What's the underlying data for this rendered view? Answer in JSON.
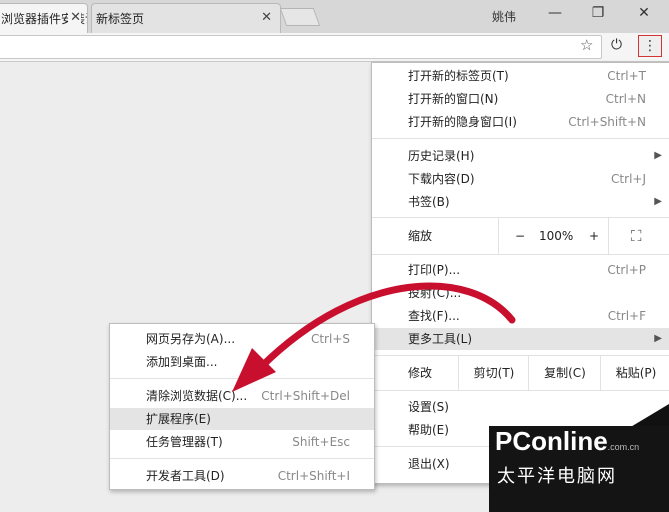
{
  "tabs": [
    {
      "title": "浏览器插件安装说",
      "close": "✕"
    },
    {
      "title": "新标签页",
      "close": "✕"
    }
  ],
  "window": {
    "user": "姚伟",
    "minimize": "—",
    "maximize": "❐",
    "close": "✕"
  },
  "toolbar": {
    "star": "☆",
    "power": "⏻",
    "menu": "⋮"
  },
  "main_menu": {
    "group1": [
      {
        "label": "打开新的标签页(T)",
        "shortcut": "Ctrl+T"
      },
      {
        "label": "打开新的窗口(N)",
        "shortcut": "Ctrl+N"
      },
      {
        "label": "打开新的隐身窗口(I)",
        "shortcut": "Ctrl+Shift+N"
      }
    ],
    "group2": [
      {
        "label": "历史记录(H)",
        "arrow": "▶"
      },
      {
        "label": "下载内容(D)",
        "shortcut": "Ctrl+J"
      },
      {
        "label": "书签(B)",
        "arrow": "▶"
      }
    ],
    "zoom": {
      "label": "缩放",
      "minus": "−",
      "value": "100%",
      "plus": "+",
      "fullscreen": "⛶"
    },
    "group3": [
      {
        "label": "打印(P)...",
        "shortcut": "Ctrl+P"
      },
      {
        "label": "投射(C)..."
      },
      {
        "label": "查找(F)...",
        "shortcut": "Ctrl+F"
      },
      {
        "label": "更多工具(L)",
        "arrow": "▶"
      }
    ],
    "edit": {
      "label": "修改",
      "cut": "剪切(T)",
      "copy": "复制(C)",
      "paste": "粘贴(P)"
    },
    "group4": [
      {
        "label": "设置(S)"
      },
      {
        "label": "帮助(E)"
      }
    ],
    "exit": {
      "label": "退出(X)"
    }
  },
  "sub_menu": {
    "group1": [
      {
        "label": "网页另存为(A)...",
        "shortcut": "Ctrl+S"
      },
      {
        "label": "添加到桌面..."
      }
    ],
    "group2": [
      {
        "label": "清除浏览数据(C)...",
        "shortcut": "Ctrl+Shift+Del"
      },
      {
        "label": "扩展程序(E)"
      },
      {
        "label": "任务管理器(T)",
        "shortcut": "Shift+Esc"
      }
    ],
    "group3": [
      {
        "label": "开发者工具(D)",
        "shortcut": "Ctrl+Shift+I"
      }
    ]
  },
  "watermark": {
    "brand": "PConline",
    "domain": ".com.cn",
    "cn": "太平洋电脑网"
  },
  "colors": {
    "arrow": "#c8102e",
    "menu_button_border": "#d23333",
    "highlight": "#e4e4e4"
  }
}
